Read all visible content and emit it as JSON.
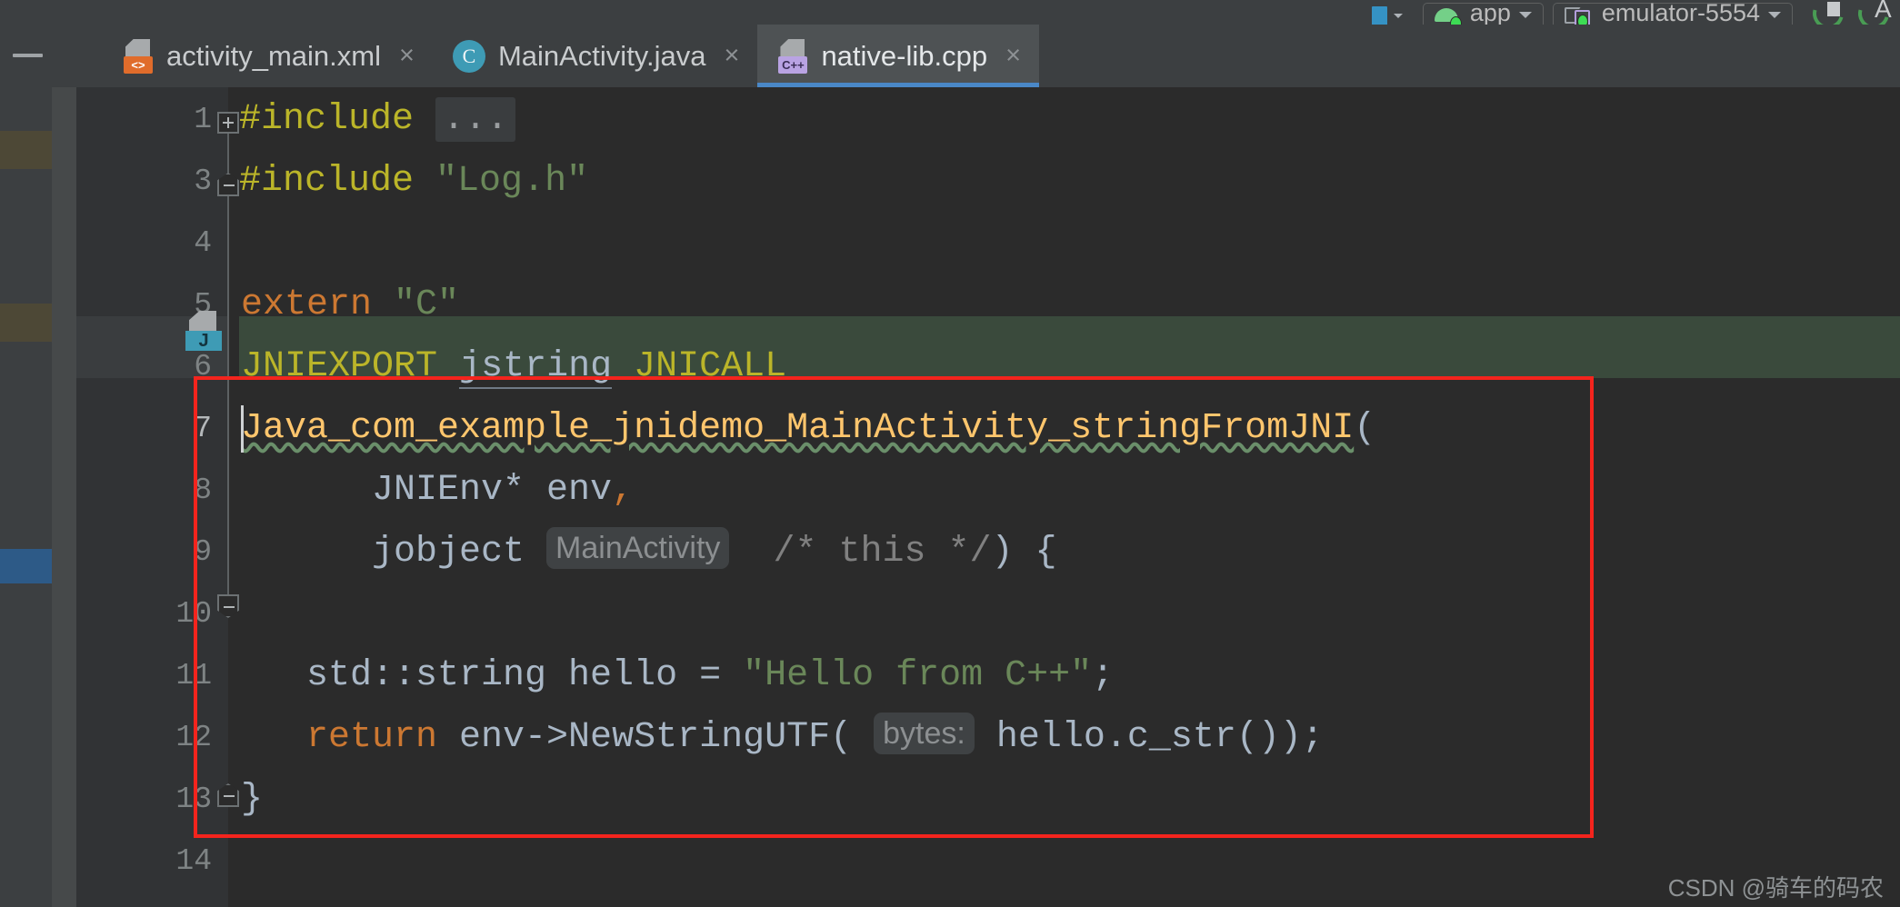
{
  "toolbar": {
    "module_selector": "app",
    "device_selector": "emulator-5554",
    "module_icon": "android-icon",
    "device_icon": "device-icon",
    "run_icon": "run-app-icon",
    "debug_icon": "debug-app-icon",
    "caret_icon": "chevron-down-icon"
  },
  "tabs": [
    {
      "label": "activity_main.xml",
      "icon": "xml-file-icon",
      "close": "×",
      "active": false
    },
    {
      "label": "MainActivity.java",
      "icon": "java-file-icon",
      "close": "×",
      "active": false
    },
    {
      "label": "native-lib.cpp",
      "icon": "cpp-file-icon",
      "close": "×",
      "active": true
    }
  ],
  "editor": {
    "file": "native-lib.cpp",
    "line_numbers": [
      "1",
      "3",
      "4",
      "5",
      "6",
      "7",
      "8",
      "9",
      "10",
      "11",
      "12",
      "13",
      "14"
    ],
    "current_line": "7",
    "gutter_java_nav": "J",
    "lines": [
      {
        "n": "1",
        "fold": "plus",
        "text": "#include ...",
        "segments": [
          {
            "t": "#include ",
            "c": "t-pre"
          },
          {
            "t": "...",
            "c": "t-fold"
          }
        ]
      },
      {
        "n": "3",
        "fold": "up",
        "text": "#include \"Log.h\"",
        "segments": [
          {
            "t": "#include ",
            "c": "t-pre"
          },
          {
            "t": "\"Log.h\"",
            "c": "t-str"
          }
        ]
      },
      {
        "n": "4",
        "fold": "",
        "text": "",
        "segments": []
      },
      {
        "n": "5",
        "fold": "",
        "text": "extern \"C\"",
        "segments": [
          {
            "t": "extern ",
            "c": "t-kw"
          },
          {
            "t": "\"C\"",
            "c": "t-str"
          }
        ]
      },
      {
        "n": "6",
        "fold": "",
        "text": "JNIEXPORT jstring JNICALL",
        "segments": [
          {
            "t": "JNIEXPORT ",
            "c": "t-macro"
          },
          {
            "t": "jstring",
            "c": "t-type"
          },
          {
            "t": " ",
            "c": ""
          },
          {
            "t": "JNICALL",
            "c": "t-macro"
          }
        ]
      },
      {
        "n": "7",
        "fold": "",
        "text": "Java_com_example_jnidemo_MainActivity_stringFromJNI(",
        "segments": [
          {
            "t": "Java_com_example_jnidemo_MainActivity_stringFromJNI",
            "c": "t-fn"
          },
          {
            "t": "(",
            "c": "t-def"
          }
        ]
      },
      {
        "n": "8",
        "fold": "",
        "text": "        JNIEnv* env,",
        "segments": [
          {
            "t": "        JNIEnv* env",
            "c": "t-type"
          },
          {
            "t": ",",
            "c": "t-kw"
          }
        ]
      },
      {
        "n": "9",
        "fold": "down",
        "text": "        jobject MainActivity  /* this */) {",
        "segments": [
          {
            "t": "        jobject ",
            "c": "t-type"
          },
          {
            "t": "MainActivity",
            "c": "hint"
          },
          {
            "t": "  ",
            "c": ""
          },
          {
            "t": "/* this */",
            "c": "t-com"
          },
          {
            "t": ") {",
            "c": "t-def"
          }
        ]
      },
      {
        "n": "10",
        "fold": "",
        "text": "",
        "segments": []
      },
      {
        "n": "11",
        "fold": "",
        "text": "    std::string hello = \"Hello from C++\";",
        "segments": [
          {
            "t": "    std::string hello = ",
            "c": "t-type"
          },
          {
            "t": "\"Hello from C++\"",
            "c": "t-str"
          },
          {
            "t": ";",
            "c": "t-def"
          }
        ]
      },
      {
        "n": "12",
        "fold": "",
        "text": "    return env->NewStringUTF( bytes: hello.c_str());",
        "segments": [
          {
            "t": "    ",
            "c": ""
          },
          {
            "t": "return",
            "c": "t-kw"
          },
          {
            "t": " env->NewStringUTF(",
            "c": "t-type"
          },
          {
            "t": "bytes:",
            "c": "hint"
          },
          {
            "t": " hello.c_str());",
            "c": "t-type"
          }
        ]
      },
      {
        "n": "13",
        "fold": "up",
        "text": "}",
        "segments": [
          {
            "t": "}",
            "c": "t-def"
          }
        ]
      },
      {
        "n": "14",
        "fold": "",
        "text": "",
        "segments": []
      }
    ],
    "inlay_hints": [
      "MainActivity",
      "bytes:"
    ],
    "annotation": {
      "type": "red-rectangle",
      "covers_lines": [
        "7",
        "8",
        "9",
        "10",
        "11",
        "12",
        "13"
      ]
    }
  },
  "code_text": {
    "l1_include": "#include",
    "l1_folded": "...",
    "l3_include": "#include",
    "l3_header": "\"Log.h\"",
    "l5_extern": "extern",
    "l5_c": "\"C\"",
    "l6_jniexport": "JNIEXPORT",
    "l6_jstring": "jstring",
    "l6_jnicall": "JNICALL",
    "l7_fn": "Java_com_example_jnidemo_MainActivity_stringFromJNI",
    "l7_paren": "(",
    "l8_param": "JNIEnv* env",
    "l8_comma": ",",
    "l9_type": "jobject",
    "l9_hint": "MainActivity",
    "l9_comment": "/* this */",
    "l9_tail": ") {",
    "l11_decl": "std::string hello = ",
    "l11_str": "\"Hello from C++\"",
    "l11_semi": ";",
    "l12_return": "return",
    "l12_call": " env->NewStringUTF(",
    "l12_hint": "bytes:",
    "l12_tail": " hello.c_str());",
    "l13_brace": "}"
  },
  "watermark": "CSDN @骑车的码农",
  "colors": {
    "background": "#2b2b2b",
    "chrome": "#3c3f41",
    "gutter": "#313335",
    "active_tab": "#4e5254",
    "tab_underline": "#4a88c7",
    "preproc_yellow": "#bbb529",
    "string_green": "#6a8759",
    "keyword_orange": "#cc7832",
    "function_tan": "#ffc66d",
    "identifier": "#a9b7c6",
    "comment_grey": "#808080",
    "annotation_red": "#f4241d",
    "highlight_row": "#3a4a3c"
  }
}
